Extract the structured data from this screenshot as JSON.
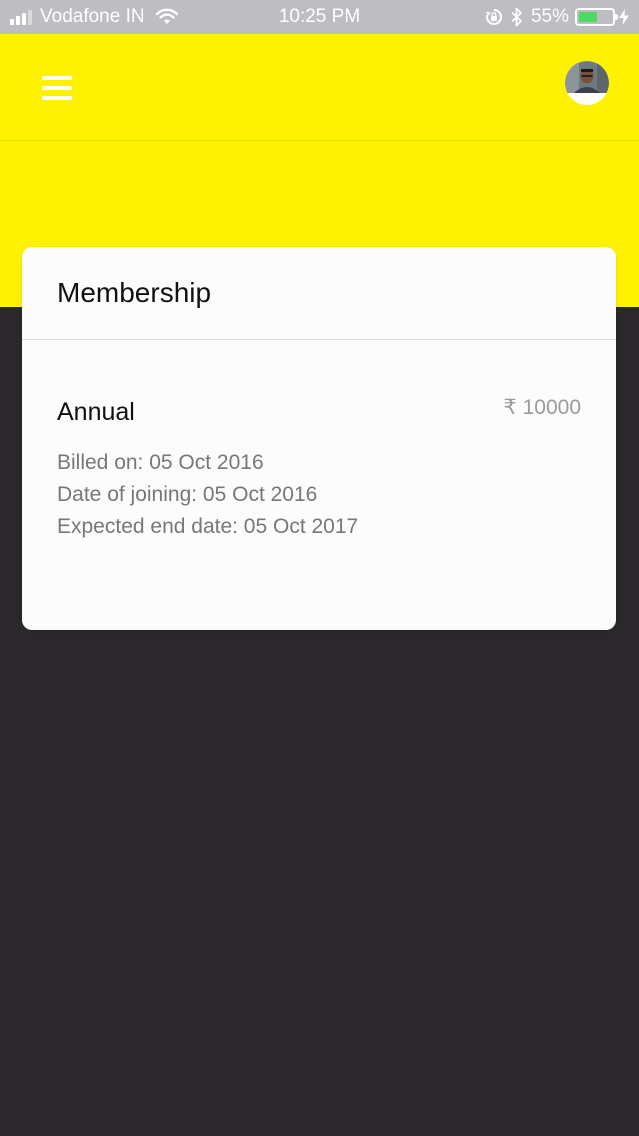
{
  "status_bar": {
    "carrier": "Vodafone IN",
    "time": "10:25 PM",
    "battery_percent": "55%",
    "battery_level": 0.55,
    "icons": [
      "signal-icon",
      "wifi-icon",
      "rotation-lock-icon",
      "bluetooth-icon",
      "battery-icon",
      "charging-icon"
    ]
  },
  "app_bar": {
    "menu_icon": "hamburger-menu-icon",
    "avatar_icon": "user-avatar",
    "background_color": "#fff200"
  },
  "membership_card": {
    "title": "Membership",
    "plan_name": "Annual",
    "price": "₹ 10000",
    "billed_on": "Billed on: 05 Oct 2016",
    "date_of_joining": "Date of joining: 05 Oct 2016",
    "expected_end_date": "Expected end date: 05 Oct 2017"
  },
  "colors": {
    "accent": "#fff200",
    "background_dark": "#2a282b",
    "card": "#fcfcfd",
    "battery_green": "#4cd964"
  }
}
